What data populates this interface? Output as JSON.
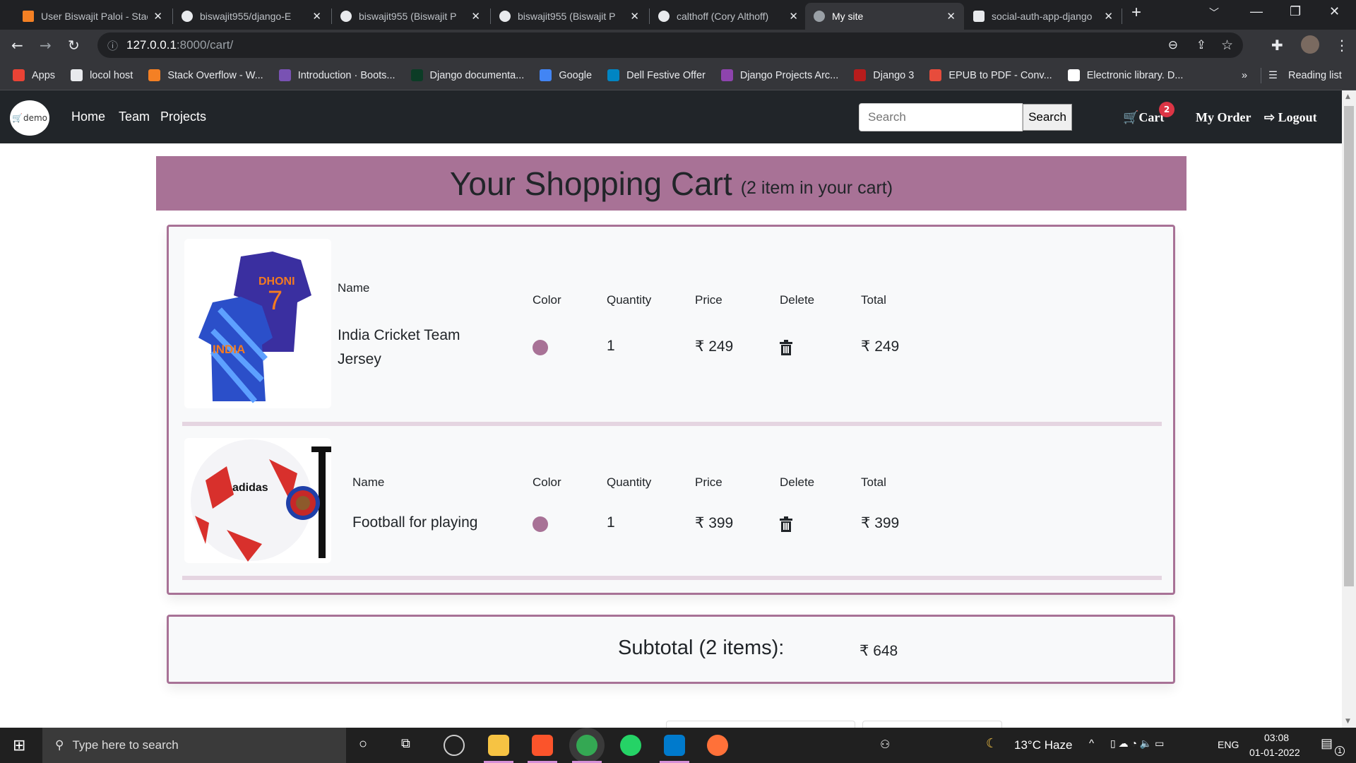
{
  "browser": {
    "tabs": [
      {
        "title": "User Biswajit Paloi - Stack Overflow",
        "icon": "stackoverflow-icon",
        "color": "#f48024"
      },
      {
        "title": "biswajit955/django-E",
        "icon": "github-icon",
        "color": "#e8eaed"
      },
      {
        "title": "biswajit955 (Biswajit P",
        "icon": "github-icon",
        "color": "#e8eaed"
      },
      {
        "title": "biswajit955 (Biswajit P",
        "icon": "github-icon",
        "color": "#e8eaed"
      },
      {
        "title": "calthoff (Cory Althoff)",
        "icon": "github-icon",
        "color": "#e8eaed"
      },
      {
        "title": "My site",
        "icon": "globe-icon",
        "color": "#9aa0a6"
      },
      {
        "title": "social-auth-app-django",
        "icon": "box-icon",
        "color": "#e8eaed"
      }
    ],
    "active_tab": 5,
    "url_host": "127.0.0.1",
    "url_path": ":8000/cart/",
    "bookmarks": [
      {
        "label": "Apps",
        "color": "#ea4335"
      },
      {
        "label": "locol host",
        "color": "#e8eaed"
      },
      {
        "label": "Stack Overflow - W...",
        "color": "#f48024"
      },
      {
        "label": "Introduction · Boots...",
        "color": "#7952b3"
      },
      {
        "label": "Django documenta...",
        "color": "#0c3c26"
      },
      {
        "label": "Google",
        "color": "#4285f4"
      },
      {
        "label": "Dell Festive Offer",
        "color": "#0085c3"
      },
      {
        "label": "Django Projects Arc...",
        "color": "#8e44ad"
      },
      {
        "label": "Django 3",
        "color": "#b71c1c"
      },
      {
        "label": "EPUB to PDF - Conv...",
        "color": "#e74c3c"
      },
      {
        "label": "Electronic library. D...",
        "color": "#ffffff"
      }
    ],
    "more": "»",
    "reading_list": "Reading list"
  },
  "site": {
    "logo_text": "demo",
    "nav": [
      "Home",
      "Team",
      "Projects"
    ],
    "search_placeholder": "Search",
    "search_button": "Search",
    "cart_label": "Cart",
    "cart_count": "2",
    "my_order": "My Order",
    "logout": "Logout"
  },
  "cart": {
    "title": "Your Shopping Cart",
    "subtitle": "(2 item in your cart)",
    "headers": {
      "name": "Name",
      "color": "Color",
      "quantity": "Quantity",
      "price": "Price",
      "delete": "Delete",
      "total": "Total"
    },
    "items": [
      {
        "name": "India Cricket Team Jersey",
        "color": "#a87296",
        "quantity": "1",
        "price": "₹ 249",
        "total": "₹ 249"
      },
      {
        "name": "Football for playing",
        "color": "#a87296",
        "quantity": "1",
        "price": "₹ 399",
        "total": "₹ 399"
      }
    ],
    "subtotal_label": "Subtotal (2 items):",
    "subtotal_value": "₹ 648"
  },
  "taskbar": {
    "search_placeholder": "Type here to search",
    "weather": "13°C  Haze",
    "lang": "ENG",
    "time": "03:08",
    "date": "01-01-2022",
    "notifications": "1"
  },
  "accent": "#a87296"
}
